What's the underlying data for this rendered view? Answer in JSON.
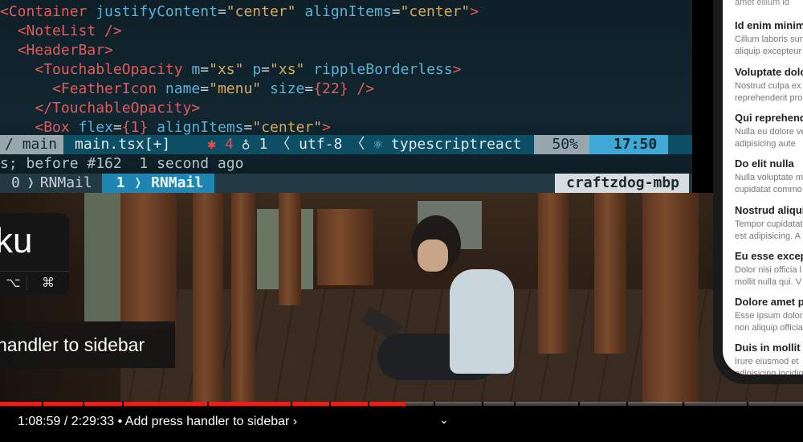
{
  "terminal": {
    "code": {
      "l1_tag_open": "<Container",
      "l1_attr1": "justifyContent",
      "l1_val1": "\"center\"",
      "l1_attr2": "alignItems",
      "l1_val2": "\"center\"",
      "l1_close": ">",
      "l2": "<NoteList />",
      "l3": "<HeaderBar>",
      "l4_tag": "<TouchableOpacity",
      "l4_attr1": "m",
      "l4_val1": "\"xs\"",
      "l4_attr2": "p",
      "l4_val2": "\"xs\"",
      "l4_attr3": "rippleBorderless",
      "l4_close": ">",
      "l5_tag": "<FeatherIcon",
      "l5_attr1": "name",
      "l5_val1": "\"menu\"",
      "l5_attr2": "size",
      "l5_val2": "{22}",
      "l5_close": "/>",
      "l6": "</TouchableOpacity>",
      "l7_tag": "<Box",
      "l7_attr1": "flex",
      "l7_val1": "{1}",
      "l7_attr2": "alignItems",
      "l7_val2": "\"center\"",
      "l7_close": ">"
    },
    "statusline": {
      "branch": "main",
      "file": "main.tsx[+]",
      "errors": "4",
      "warnings": "1",
      "encoding": "utf-8",
      "filetype": "typescriptreact",
      "percent": "50%",
      "time": "17:50"
    },
    "cmdline": "s; before #162  1 second ago",
    "tmux": {
      "window0_index": "0",
      "window0_name": "RNMail",
      "window1_index": "1",
      "window1_name": "RNMail",
      "hostname": "craftzdog-mbp"
    }
  },
  "overlay": {
    "shortcut_big": "ku",
    "key1": "⌥",
    "key2": "⌘",
    "chapter_tooltip": "handler to sidebar"
  },
  "phone": {
    "top_fragment": "amet ellium id",
    "notes": [
      {
        "title": "Id enim minim",
        "line1": "Cillum laboris sunt",
        "line2": "aliquip excepteur"
      },
      {
        "title": "Voluptate dolo",
        "line1": "Nostrud culpa ex",
        "line2": "reprehenderit pro"
      },
      {
        "title": "Qui reprehend",
        "line1": "Nulla eu dolore ve",
        "line2": "adipisicing aute"
      },
      {
        "title": "Do elit nulla",
        "line1": "Nulla voluptate m",
        "line2": "cupidatat commo"
      },
      {
        "title": "Nostrud aliqui",
        "line1": "Tempor cupidatat",
        "line2": "est adipisicing. A"
      },
      {
        "title": "Eu esse excep",
        "line1": "Dolor nisi officia l",
        "line2": "mollit nulla qui. V"
      },
      {
        "title": "Dolore amet p",
        "line1": "Esse ipsum dolor",
        "line2": "non aliquip officia"
      },
      {
        "title": "Duis in mollit i",
        "line1": "Irure eiusmod et",
        "line2": "adipisicing incidin"
      }
    ]
  },
  "player": {
    "progress_fraction": 0.505,
    "current_time": "1:08:59",
    "duration": "2:29:33",
    "chapter_title": "Add press handler to sidebar",
    "chapter_arrow": "›",
    "separator": "/",
    "bullet": "•",
    "expand_icon": "chevron-down-icon"
  },
  "colors": {
    "progress_red": "#e62117",
    "tag_red": "#e35a5a",
    "attr_blue": "#5ab3d6",
    "string_orange": "#d6a85f",
    "statusline_bg": "#0c4e63",
    "time_bg": "#3ea8d6"
  }
}
